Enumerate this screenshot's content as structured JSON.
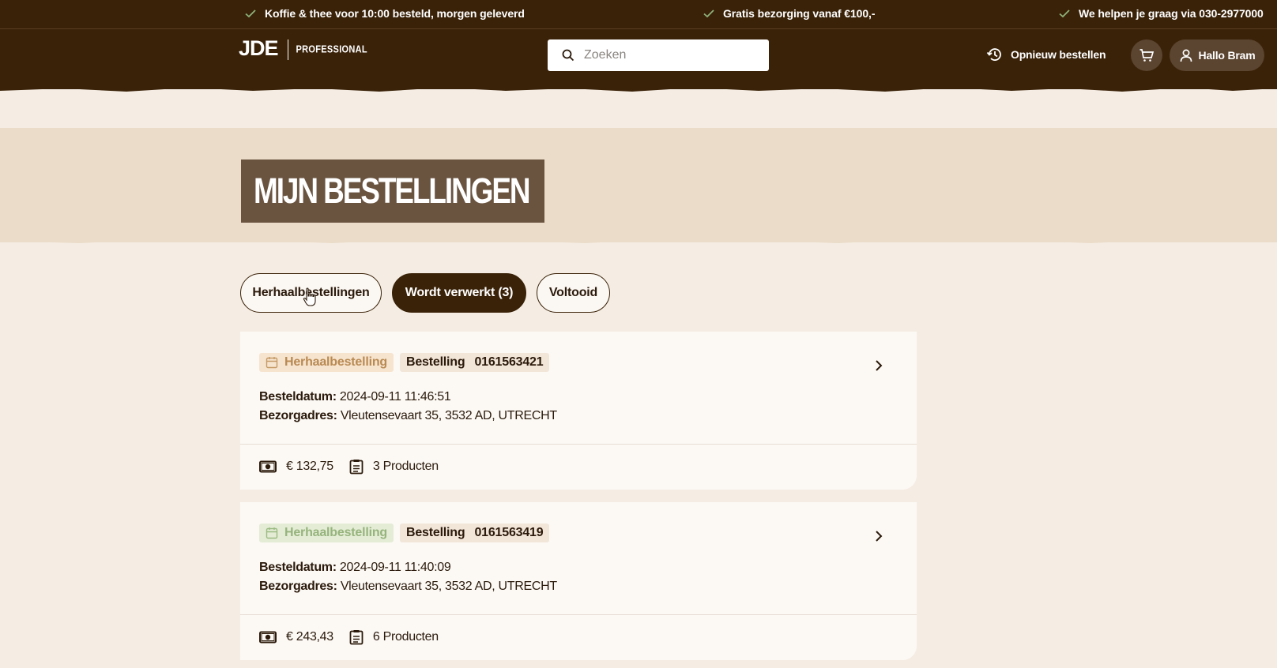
{
  "usp": [
    "Koffie & thee voor 10:00 besteld, morgen geleverd",
    "Gratis bezorging vanaf €100,-",
    "We helpen je graag via 030-2977000"
  ],
  "header": {
    "logo_mark": "JDE",
    "logo_text": "PROFESSIONAL",
    "search_placeholder": "Zoeken",
    "reorder_label": "Opnieuw bestellen",
    "user_label": "Hallo Bram"
  },
  "page": {
    "title": "MIJN BESTELLINGEN"
  },
  "tabs": [
    {
      "label": "Herhaalbestellingen",
      "active": false
    },
    {
      "label": "Wordt verwerkt (3)",
      "active": true
    },
    {
      "label": "Voltooid",
      "active": false
    }
  ],
  "orders": [
    {
      "type_label": "Herhaalbestelling",
      "order_label": "Bestelling",
      "order_number": "0161563421",
      "date_label": "Besteldatum:",
      "date_value": "2024-09-11 11:46:51",
      "address_label": "Bezorgadres:",
      "address_value": "Vleutensevaart 35, 3532 AD, UTRECHT",
      "amount": "€ 132,75",
      "products": "3 Producten"
    },
    {
      "type_label": "Herhaalbestelling",
      "order_label": "Bestelling",
      "order_number": "0161563419",
      "date_label": "Besteldatum:",
      "date_value": "2024-09-11 11:40:09",
      "address_label": "Bezorgadres:",
      "address_value": "Vleutensevaart 35, 3532 AD, UTRECHT",
      "amount": "€ 243,43",
      "products": "6 Producten"
    }
  ],
  "colors": {
    "header_bg": "#3a2208",
    "hero_bg": "#ebdcc9",
    "page_bg": "#f5ede4",
    "title_bg": "#6a5440",
    "check_green": "#8fb27a"
  }
}
